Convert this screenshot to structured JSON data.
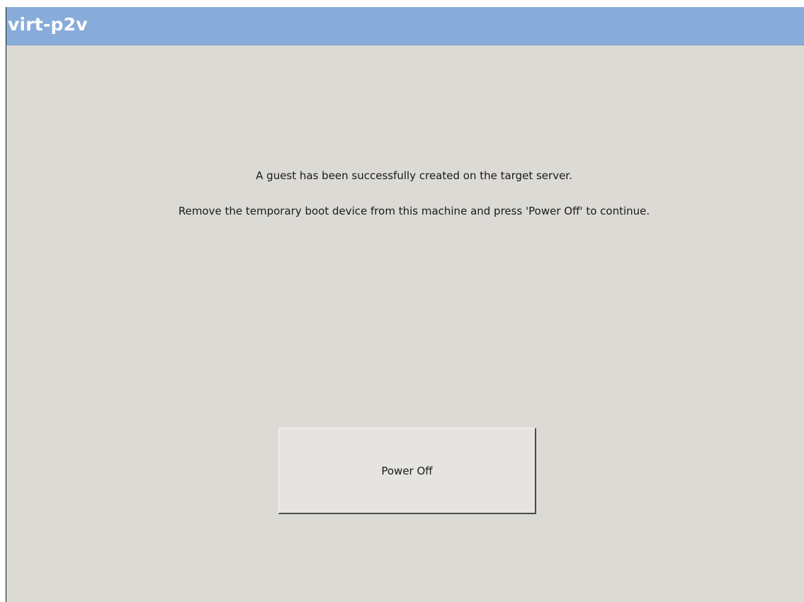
{
  "window": {
    "title": "virt-p2v"
  },
  "main": {
    "message_line1": "A guest has been successfully created on the target server.",
    "message_line2": "Remove the temporary boot device from this machine and press 'Power Off' to continue."
  },
  "actions": {
    "power_off_label": "Power Off"
  },
  "colors": {
    "titlebar": "#88acd9",
    "background": "#dcdad5"
  }
}
